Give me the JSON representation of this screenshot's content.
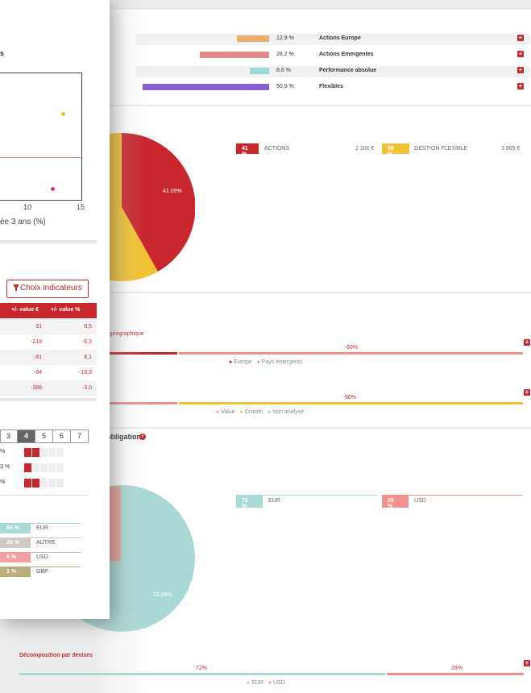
{
  "allocation": {
    "rows": [
      {
        "pct": "12,9 %",
        "label": "Actions Europe",
        "color": "#e8b06a"
      },
      {
        "pct": "28,2 %",
        "label": "Actions Emergentes",
        "color": "#e08a8a"
      },
      {
        "pct": "8,8 %",
        "label": "Performance absolue",
        "color": "#9ed9d9"
      },
      {
        "pct": "50,9 %",
        "label": "Flexibles",
        "color": "#8a5fd1"
      }
    ]
  },
  "pie1": {
    "slice_label": "41.09%",
    "legend": [
      {
        "pct": "41 %",
        "label": "ACTIONS",
        "amount": "2 200 €",
        "color": "#c8282d"
      },
      {
        "pct": "59 %",
        "label": "GESTION FLEXIBLE",
        "amount": "3 865 €",
        "color": "#f1c232"
      }
    ]
  },
  "geo": {
    "title": "Répartition géographique",
    "bar_label": "60%",
    "legend": [
      "Europe",
      "Pays émergents"
    ]
  },
  "style_bar": {
    "bar_label": "60%",
    "legend": [
      "Value",
      "Growth",
      "Non analysé"
    ]
  },
  "obligations": {
    "title": "Décomposition des obligations",
    "pie_label": "72.09%",
    "legend": [
      {
        "pct": "72 %",
        "label": "EUR",
        "color": "#9ed3d0"
      },
      {
        "pct": "28 %",
        "label": "USD",
        "color": "#f1908c"
      }
    ]
  },
  "devises": {
    "title": "Décomposition par devises",
    "left_label": "72%",
    "right_label": "28%",
    "legend": [
      "EUR",
      "USD"
    ]
  },
  "front": {
    "heading_tail": "s",
    "scatter": {
      "x_ticks": [
        "10",
        "15"
      ],
      "x_label": "ée 3 ans (%)"
    },
    "indicators_button": "Choix indicateurs",
    "table": {
      "headers": [
        "+/- value €",
        "+/- value %"
      ],
      "rows": [
        [
          "31",
          "0,5"
        ],
        [
          "-219",
          "-6,3"
        ],
        [
          "81",
          "8,1"
        ],
        [
          "-84",
          "-18,9"
        ],
        [
          "-386",
          "-3,0"
        ]
      ]
    },
    "risk_scale": [
      "3",
      "4",
      "5",
      "6",
      "7"
    ],
    "risk_rows": [
      {
        "label": "%",
        "filled": 2
      },
      {
        "label": "3 %",
        "filled": 1
      },
      {
        "label": "%",
        "filled": 2
      }
    ],
    "currencies": [
      {
        "pct": "68 %",
        "code": "EUR",
        "color": "#a9d9d5"
      },
      {
        "pct": "26 %",
        "code": "AUTRE",
        "color": "#cfc8c6"
      },
      {
        "pct": "6 %",
        "code": "USD",
        "color": "#f3a0a0"
      },
      {
        "pct": "1 %",
        "code": "GBP",
        "color": "#b9ae7c"
      }
    ]
  }
}
